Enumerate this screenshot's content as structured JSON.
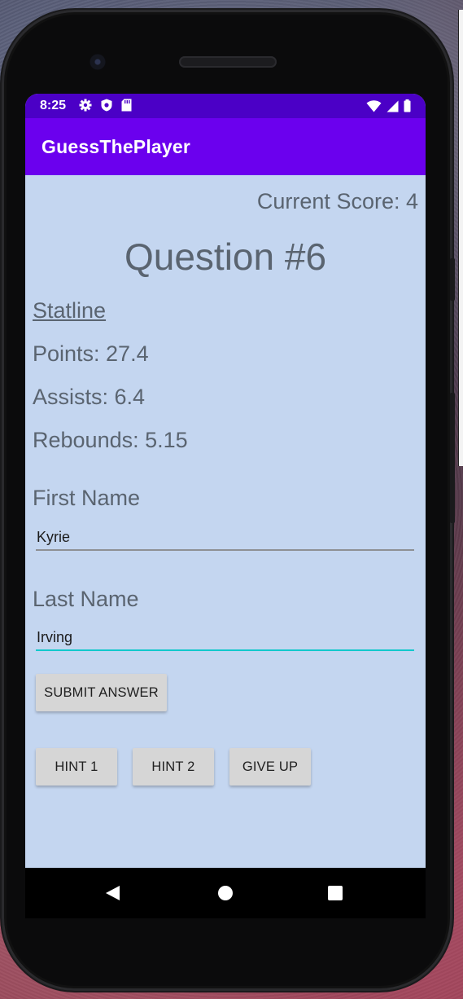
{
  "status_bar": {
    "time": "8:25"
  },
  "app_bar": {
    "title": "GuessThePlayer"
  },
  "score": "Current Score: 4",
  "question": "Question #6",
  "statline": {
    "heading": "Statline",
    "points": "Points: 27.4",
    "assists": "Assists: 6.4",
    "rebounds": "Rebounds: 5.15"
  },
  "form": {
    "first_name_label": "First Name",
    "first_name_value": "Kyrie",
    "last_name_label": "Last Name",
    "last_name_value": "Irving"
  },
  "buttons": {
    "submit": "SUBMIT ANSWER",
    "hint1": "HINT 1",
    "hint2": "HINT 2",
    "give_up": "GIVE UP"
  },
  "icons": {
    "status": [
      "gear-icon",
      "shield-icon",
      "sd-card-icon"
    ],
    "status_right": [
      "wifi-icon",
      "signal-icon",
      "battery-icon"
    ],
    "nav": [
      "back-icon",
      "home-icon",
      "recents-icon"
    ]
  },
  "colors": {
    "status_bar": "#4b00c6",
    "app_bar": "#6b00ee",
    "background": "#c4d6f0",
    "accent_underline": "#12c8cc",
    "button": "#d6d6d6"
  }
}
